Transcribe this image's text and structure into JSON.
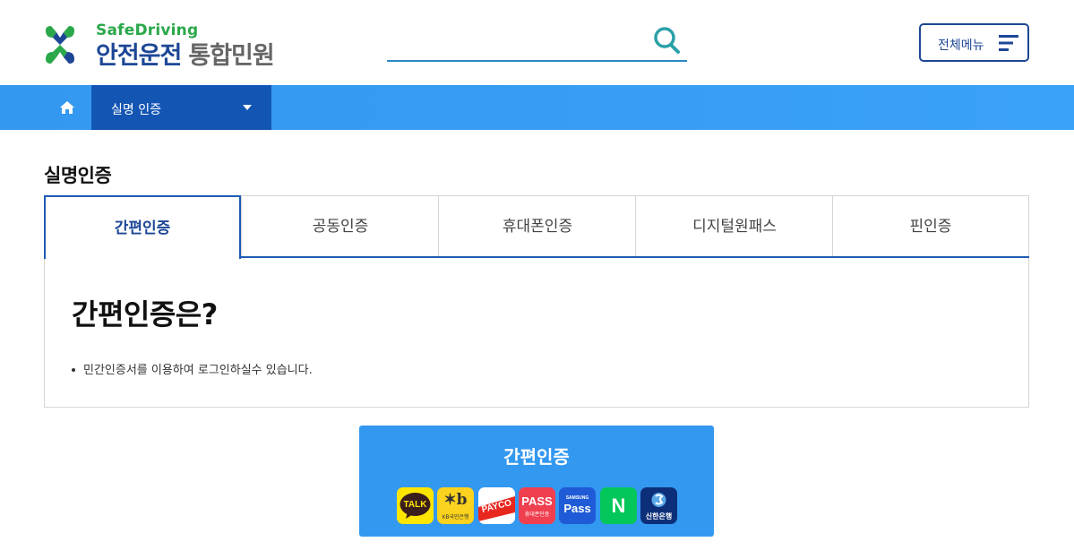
{
  "header": {
    "logo_sub": "SafeDriving",
    "logo_main": "안전운전",
    "logo_main_gray": "통합민원",
    "search_placeholder": "",
    "menu_button_label": "전체메뉴"
  },
  "navbar": {
    "home_icon": "home-icon",
    "selected_menu": "실명 인증"
  },
  "page": {
    "title": "실명인증"
  },
  "tabs": [
    {
      "label": "간편인증",
      "active": true
    },
    {
      "label": "공동인증",
      "active": false
    },
    {
      "label": "휴대폰인증",
      "active": false
    },
    {
      "label": "디지털원패스",
      "active": false
    },
    {
      "label": "핀인증",
      "active": false
    }
  ],
  "content": {
    "heading": "간편인증은?",
    "bullets": [
      "민간인증서를 이용하여 로그인하실수 있습니다."
    ]
  },
  "cert_button": {
    "title": "간편인증",
    "providers": [
      {
        "name": "kakao-icon",
        "label": "TALK",
        "bg": "#fee500"
      },
      {
        "name": "kb-icon",
        "label": "KB국민은행",
        "bg": "#fbd21d"
      },
      {
        "name": "payco-icon",
        "label": "PAYCO",
        "bg": "#ffffff"
      },
      {
        "name": "pass-icon",
        "label": "PASS",
        "sublabel": "휴대폰인증",
        "bg": "#f04050"
      },
      {
        "name": "samsung-pass-icon",
        "label": "Pass",
        "sublabel": "SAMSUNG",
        "bg": "#1f5bd6"
      },
      {
        "name": "naver-icon",
        "label": "N",
        "bg": "#03c75a"
      },
      {
        "name": "shinhan-icon",
        "label": "신한은행",
        "bg": "#0d2f7a"
      }
    ]
  },
  "colors": {
    "primary_navy": "#1d4796",
    "nav_blue": "#3398f0",
    "nav_selected": "#1355b3",
    "logo_green": "#2aa84a"
  }
}
